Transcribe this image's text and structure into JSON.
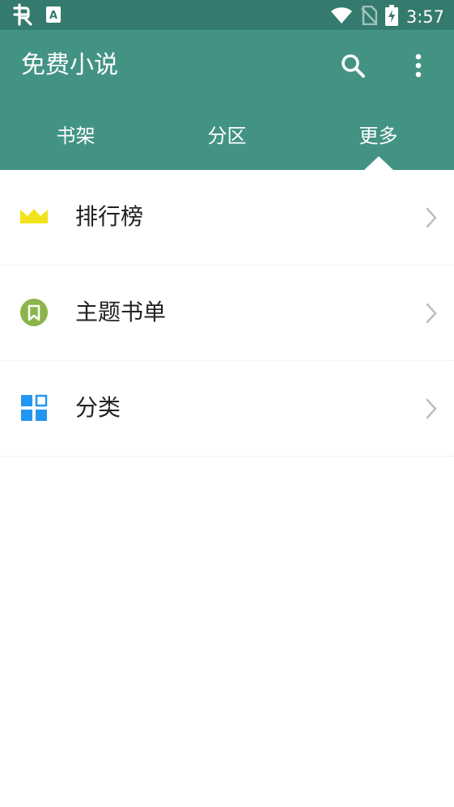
{
  "status_bar": {
    "time": "3:57",
    "icons": [
      "bug-icon",
      "text-a-icon",
      "wifi-icon",
      "no-sim-icon",
      "battery-charging-icon"
    ]
  },
  "app_bar": {
    "title": "免费小说",
    "actions": [
      "search-icon",
      "more-vertical-icon"
    ]
  },
  "tabs": [
    {
      "label": "书架",
      "active": false
    },
    {
      "label": "分区",
      "active": false
    },
    {
      "label": "更多",
      "active": true
    }
  ],
  "list": [
    {
      "label": "排行榜",
      "icon": "crown-icon",
      "icon_color": "#f2e21b"
    },
    {
      "label": "主题书单",
      "icon": "bookmark-circle-icon",
      "icon_color": "#8bb54a"
    },
    {
      "label": "分类",
      "icon": "grid-icon",
      "icon_color": "#2196f3"
    }
  ],
  "colors": {
    "status_bar": "#357a6e",
    "app_bar": "#439385",
    "chevron": "#bdbdbd"
  }
}
